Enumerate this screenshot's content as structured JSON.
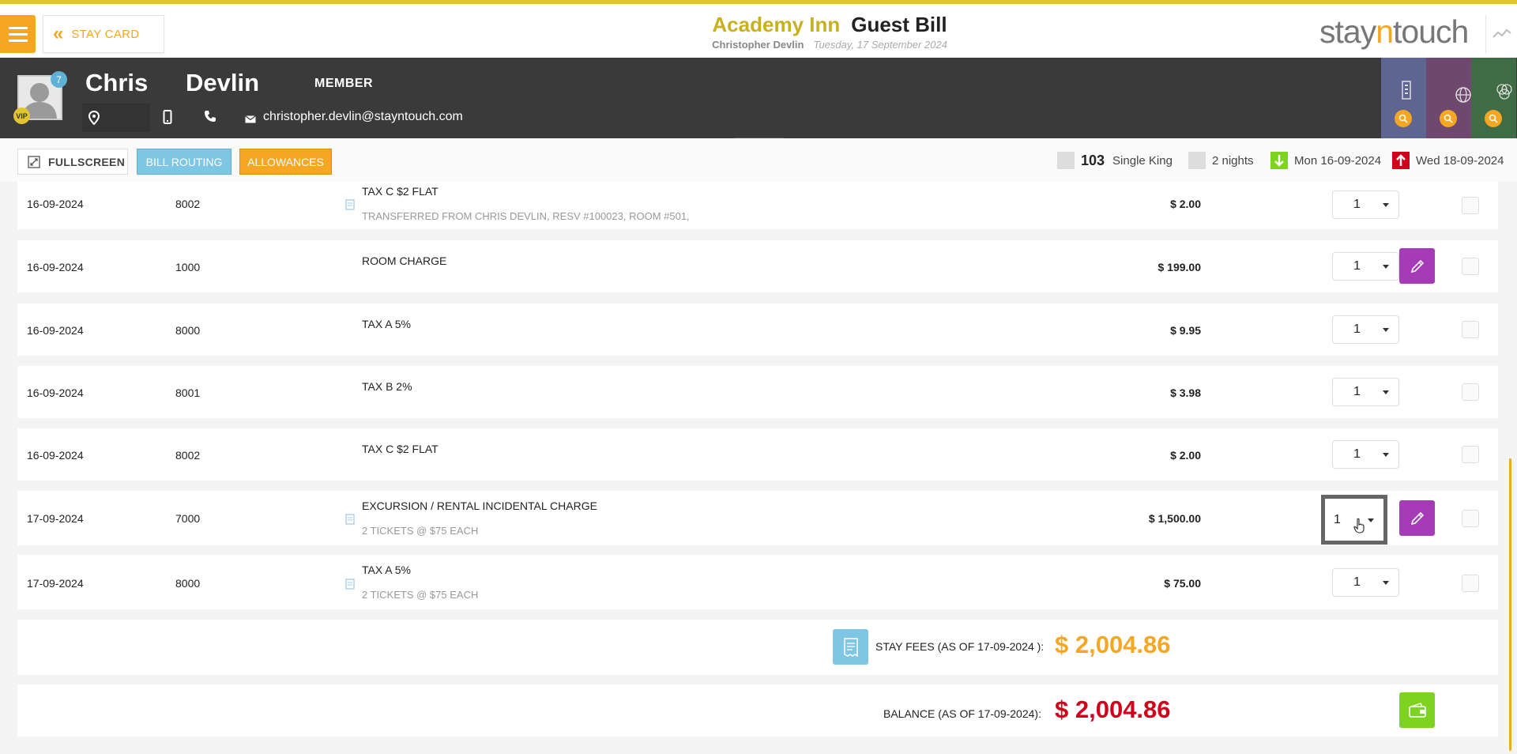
{
  "header": {
    "back_label": "STAY CARD",
    "hotel_name": "Academy Inn",
    "page_title": "Guest Bill",
    "guest_full_name": "Christopher Devlin",
    "date": "Tuesday, 17 September 2024",
    "brand_pre": "stay",
    "brand_n": "n",
    "brand_post": "touch"
  },
  "guest": {
    "first_name": "Chris",
    "last_name": "Devlin",
    "membership": "MEMBER",
    "notification_count": "7",
    "vip": "VIP",
    "email": "christopher.devlin@stayntouch.com"
  },
  "actions": {
    "fullscreen": "FULLSCREEN",
    "bill_routing": "BILL ROUTING",
    "allowances": "ALLOWANCES"
  },
  "stay": {
    "room_number": "103",
    "room_type": "Single King",
    "nights": "2 nights",
    "arrival": "Mon 16-09-2024",
    "departure": "Wed 18-09-2024"
  },
  "transactions": [
    {
      "date": "16-09-2024",
      "code": "8002",
      "description": "TAX C $2 FLAT",
      "detail": "TRANSFERRED FROM CHRIS DEVLIN, RESV #100023, ROOM #501,",
      "amount": "$ 2.00",
      "qty": "1"
    },
    {
      "date": "16-09-2024",
      "code": "1000",
      "description": "ROOM CHARGE",
      "detail": "",
      "amount": "$ 199.00",
      "qty": "1"
    },
    {
      "date": "16-09-2024",
      "code": "8000",
      "description": "TAX A 5%",
      "detail": "",
      "amount": "$ 9.95",
      "qty": "1"
    },
    {
      "date": "16-09-2024",
      "code": "8001",
      "description": "TAX B 2%",
      "detail": "",
      "amount": "$ 3.98",
      "qty": "1"
    },
    {
      "date": "16-09-2024",
      "code": "8002",
      "description": "TAX C $2 FLAT",
      "detail": "",
      "amount": "$ 2.00",
      "qty": "1"
    },
    {
      "date": "17-09-2024",
      "code": "7000",
      "description": "EXCURSION / RENTAL INCIDENTAL CHARGE",
      "detail": "2 TICKETS @ $75 EACH",
      "amount": "$ 1,500.00",
      "qty": "1"
    },
    {
      "date": "17-09-2024",
      "code": "8000",
      "description": "TAX A 5%",
      "detail": "2 TICKETS @ $75 EACH",
      "amount": "$ 75.00",
      "qty": "1"
    }
  ],
  "totals": {
    "stay_fees_label": "STAY FEES (AS OF  17-09-2024 ):",
    "stay_fees_value": "$ 2,004.86",
    "balance_label": "BALANCE (AS OF  17-09-2024):",
    "balance_value": "$ 2,004.86"
  },
  "colors": {
    "accent": "#f5a623",
    "header_dark": "#3a3a3a",
    "edit": "#a63bb8",
    "balance": "#d0021b",
    "hotel_title": "#c9b020"
  }
}
